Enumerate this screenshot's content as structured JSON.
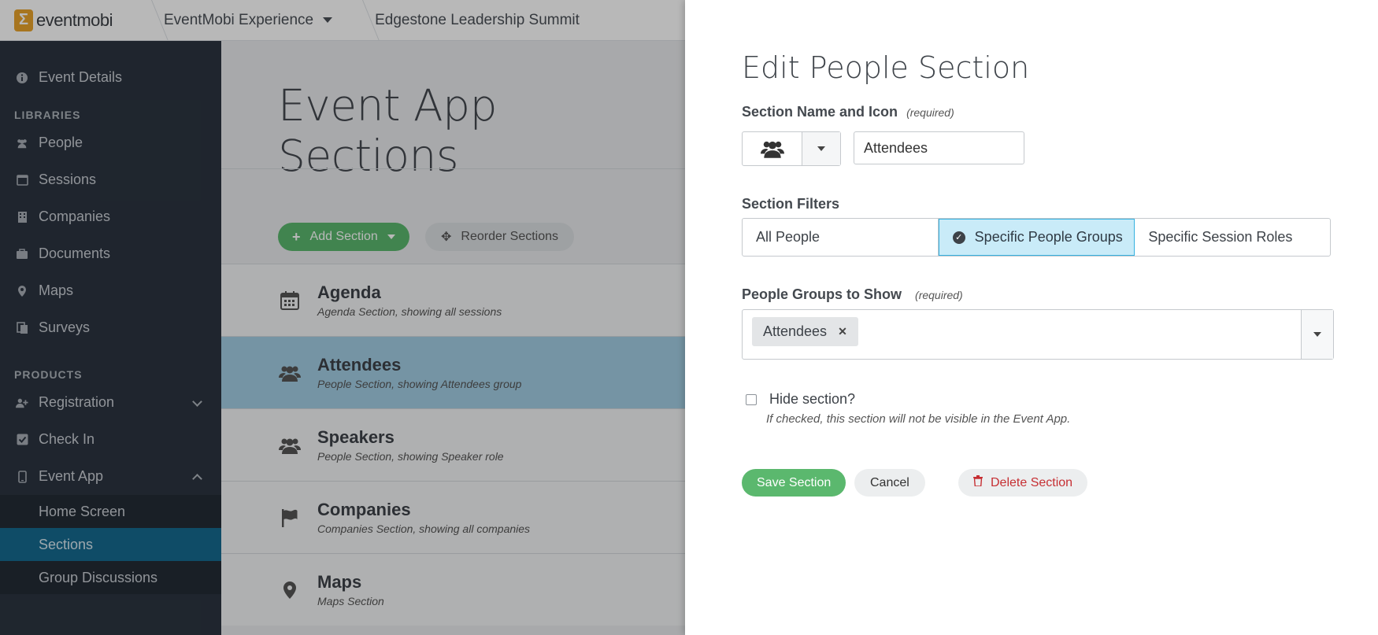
{
  "topbar": {
    "logo_text": "eventmobi",
    "crumb_experience": "EventMobi Experience",
    "crumb_event": "Edgestone Leadership Summit"
  },
  "sidebar": {
    "event_details": "Event Details",
    "libraries_heading": "LIBRARIES",
    "libraries": [
      "People",
      "Sessions",
      "Companies",
      "Documents",
      "Maps",
      "Surveys"
    ],
    "products_heading": "PRODUCTS",
    "products": [
      "Registration",
      "Check In",
      "Event App"
    ],
    "event_app_sub": [
      "Home Screen",
      "Sections",
      "Group Discussions"
    ],
    "active_sub": "Sections"
  },
  "main": {
    "title": "Event App Sections",
    "add_label": "Add Section",
    "reorder_label": "Reorder Sections",
    "sections": [
      {
        "name": "Agenda",
        "desc": "Agenda Section, showing all sessions",
        "icon": "calendar-icon"
      },
      {
        "name": "Attendees",
        "desc": "People Section, showing Attendees group",
        "icon": "people-icon"
      },
      {
        "name": "Speakers",
        "desc": "People Section, showing Speaker role",
        "icon": "people-icon"
      },
      {
        "name": "Companies",
        "desc": "Companies Section, showing all companies",
        "icon": "flag-icon"
      },
      {
        "name": "Maps",
        "desc": "Maps Section",
        "icon": "map-pin-icon"
      }
    ]
  },
  "panel": {
    "title": "Edit People Section",
    "name_label": "Section Name and Icon",
    "required": "(required)",
    "name_value": "Attendees",
    "filters_label": "Section Filters",
    "filters": [
      "All People",
      "Specific People Groups",
      "Specific Session Roles"
    ],
    "active_filter": "Specific People Groups",
    "groups_label": "People Groups to Show",
    "groups_selected": [
      "Attendees"
    ],
    "hide_label": "Hide section?",
    "hide_help": "If checked, this section will not be visible in the Event App.",
    "save": "Save Section",
    "cancel": "Cancel",
    "delete": "Delete Section"
  },
  "colors": {
    "sidebar_bg": "#2b3440",
    "active_blue": "#166a8f",
    "green": "#5bb86e",
    "delete_red": "#c62f33",
    "seg_active_bg": "#c9ebf8"
  }
}
